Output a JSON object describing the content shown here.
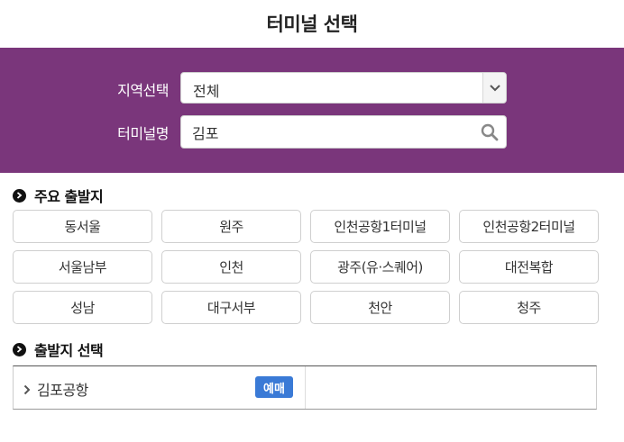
{
  "header": {
    "title": "터미널 선택"
  },
  "search": {
    "region_label": "지역선택",
    "region_value": "전체",
    "terminal_label": "터미널명",
    "terminal_value": "김포"
  },
  "major": {
    "heading": "주요 출발지",
    "terminals": [
      "동서울",
      "원주",
      "인천공항1터미널",
      "인천공항2터미널",
      "서울남부",
      "인천",
      "광주(유·스퀘어)",
      "대전복합",
      "성남",
      "대구서부",
      "천안",
      "청주"
    ]
  },
  "departure": {
    "heading": "출발지 선택",
    "items": [
      {
        "name": "김포공항",
        "badge": "예매"
      }
    ]
  },
  "colors": {
    "panel": "#7a367b",
    "badge": "#3a7ad6"
  },
  "icons": [
    "chevron-down-icon",
    "search-icon",
    "chevron-right-icon",
    "circle-arrow-icon"
  ]
}
